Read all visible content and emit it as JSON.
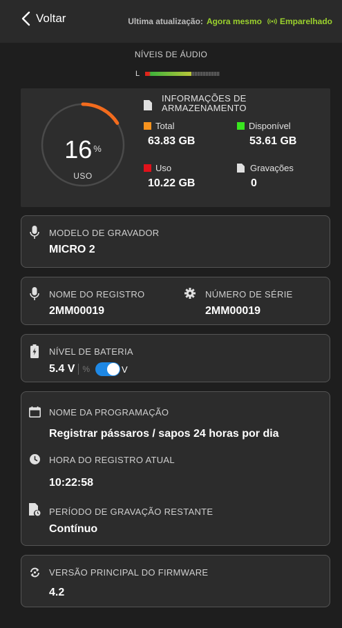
{
  "header": {
    "back_label": "Voltar",
    "update_label": "Ultima atualização:",
    "update_value": "Agora mesmo",
    "paired_label": "Emparelhado",
    "accent_color": "#9bd12d"
  },
  "audio": {
    "title": "NÍVEIS DE ÁUDIO",
    "channel": "L",
    "level_fraction": 0.62
  },
  "storage": {
    "title": "INFORMAÇÕES DE ARMAZENAMENTO",
    "gauge_percent": "16",
    "percent_symbol": "%",
    "gauge_label": "USO",
    "gauge_fraction": 0.16,
    "total": {
      "label": "Total",
      "value": "63.83 GB",
      "color": "#f7931e"
    },
    "available": {
      "label": "Disponível",
      "value": "53.61 GB",
      "color": "#39e61f"
    },
    "used": {
      "label": "Uso",
      "value": "10.22 GB",
      "color": "#e0121b"
    },
    "recordings": {
      "label": "Gravações",
      "value": "0",
      "icon": "document-icon"
    }
  },
  "recorder_model": {
    "label": "MODELO DE GRAVADOR",
    "value": "MICRO 2",
    "icon": "microphone-icon"
  },
  "record_name": {
    "label": "NOME DO REGISTRO",
    "value": "2MM00019",
    "icon": "microphone-icon"
  },
  "serial_number": {
    "label": "NÚMERO DE SÉRIE",
    "value": "2MM00019",
    "icon": "gear-icon"
  },
  "battery": {
    "label": "NÍVEL DE BATERIA",
    "value": "5.4 V",
    "percent_option": "%",
    "volt_option": "V",
    "toggle_on": true,
    "icon": "battery-icon"
  },
  "schedule": {
    "name_label": "NOME DA PROGRAMAÇÃO",
    "name_value": "Registrar pássaros / sapos 24 horas por dia",
    "time_label": "HORA DO REGISTRO ATUAL",
    "time_value": "10:22:58",
    "remaining_label": "PERÍODO DE GRAVAÇÃO RESTANTE",
    "remaining_value": "Contínuo"
  },
  "firmware": {
    "label": "VERSÃO PRINCIPAL DO FIRMWARE",
    "value": "4.2",
    "icon": "sync-icon"
  }
}
